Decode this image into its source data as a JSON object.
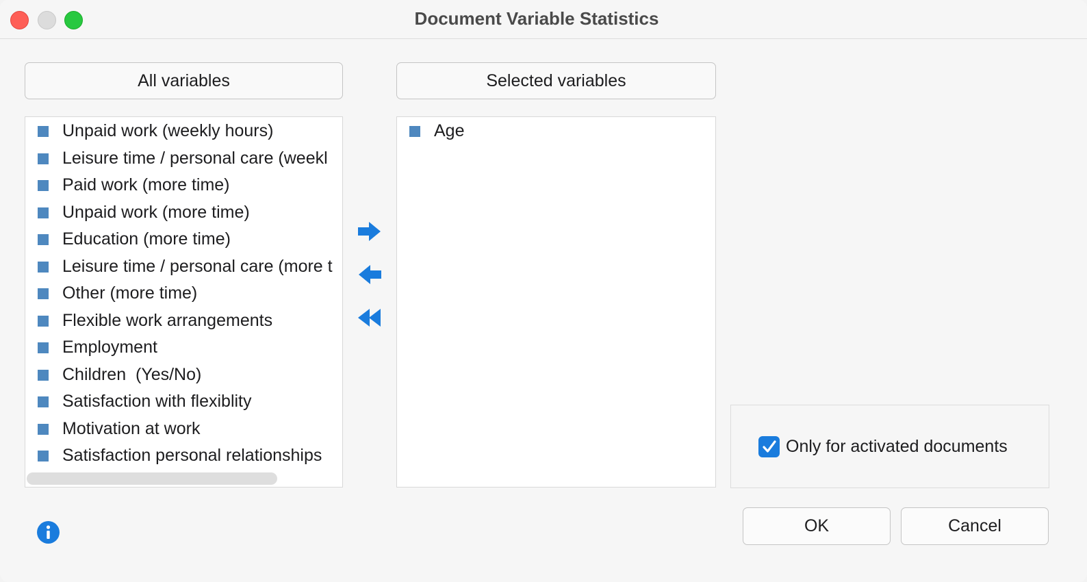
{
  "window": {
    "title": "Document Variable Statistics"
  },
  "panels": {
    "all_label": "All variables",
    "selected_label": "Selected variables"
  },
  "all_variables": [
    "Unpaid work (weekly hours)",
    "Leisure time / personal care (weekl",
    "Paid work (more time)",
    "Unpaid work (more time)",
    "Education (more time)",
    "Leisure time / personal care (more t",
    "Other (more time)",
    "Flexible work arrangements",
    "Employment",
    "Children  (Yes/No)",
    "Satisfaction with flexiblity",
    "Motivation at work",
    "Satisfaction personal relationships"
  ],
  "selected_variables": [
    "Age"
  ],
  "options": {
    "only_activated_label": "Only for activated documents",
    "only_activated_checked": true
  },
  "buttons": {
    "ok": "OK",
    "cancel": "Cancel"
  },
  "colors": {
    "accent": "#1a7cdd",
    "item_marker": "#4e88bf",
    "arrow": "#1a7cdd"
  },
  "icons": {
    "add": "arrow-right-icon",
    "remove": "arrow-left-icon",
    "remove_all": "double-arrow-left-icon",
    "info": "info-icon"
  }
}
